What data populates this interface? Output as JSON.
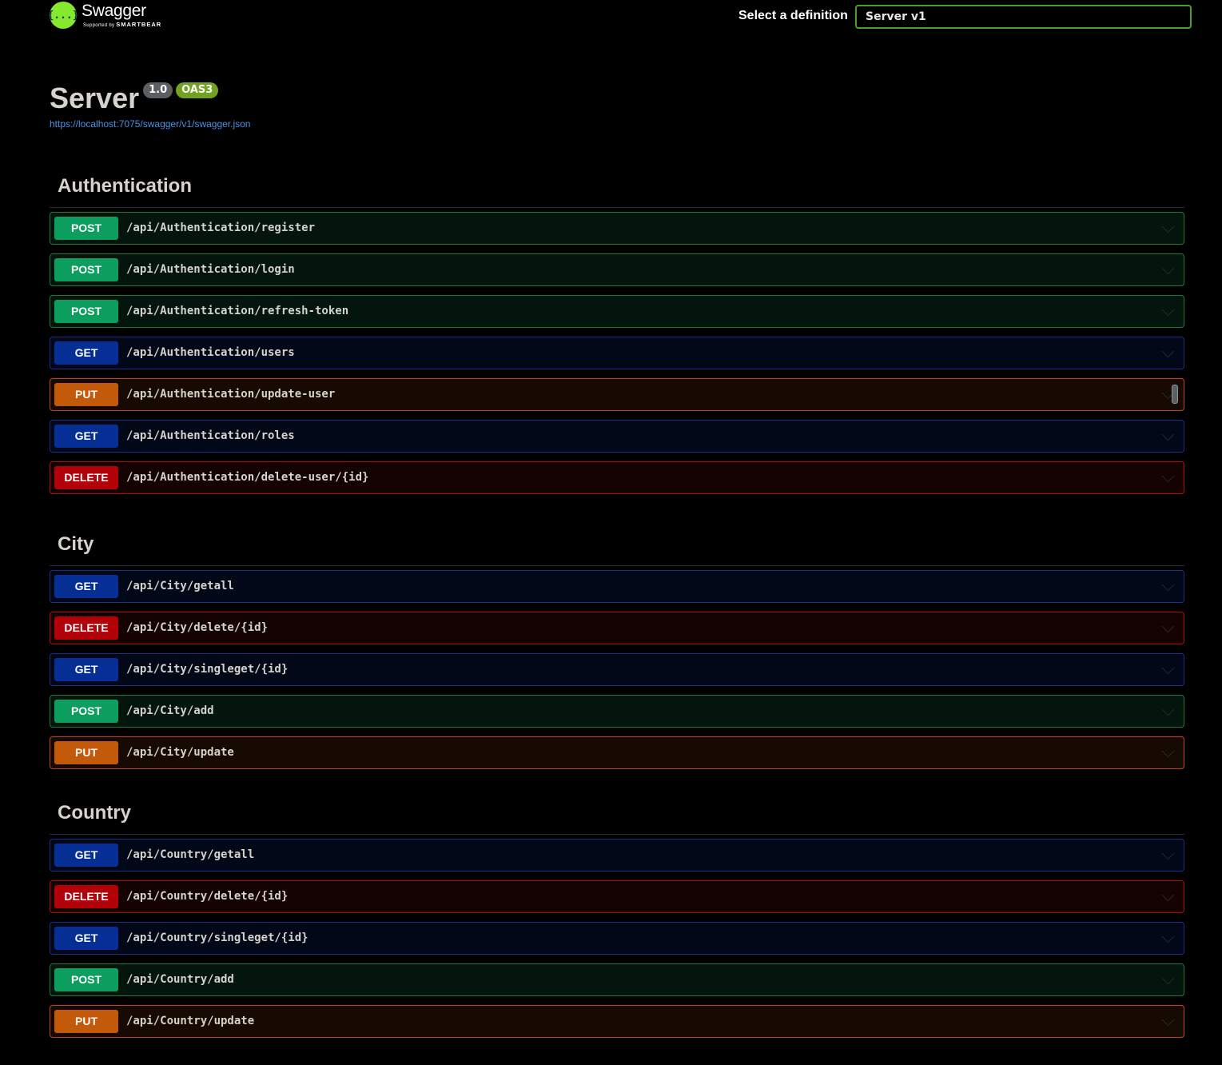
{
  "header": {
    "logo_word": "Swagger",
    "logo_sub_prefix": "Supported by ",
    "logo_sub_brand": "SMARTBEAR",
    "logo_glyph": "{...}",
    "definition_label": "Select a definition",
    "definition_value": "Server v1"
  },
  "info": {
    "title": "Server",
    "version": "1.0",
    "oas": "OAS3",
    "spec_url": "https://localhost:7075/swagger/v1/swagger.json"
  },
  "colors": {
    "post": "#0b9e5e",
    "get": "#062f96",
    "put": "#c25a0a",
    "delete": "#b20109",
    "logo": "#85ea2d"
  },
  "sections": [
    {
      "title": "Authentication",
      "operations": [
        {
          "method": "POST",
          "path": "/api/Authentication/register"
        },
        {
          "method": "POST",
          "path": "/api/Authentication/login"
        },
        {
          "method": "POST",
          "path": "/api/Authentication/refresh-token"
        },
        {
          "method": "GET",
          "path": "/api/Authentication/users"
        },
        {
          "method": "PUT",
          "path": "/api/Authentication/update-user"
        },
        {
          "method": "GET",
          "path": "/api/Authentication/roles"
        },
        {
          "method": "DELETE",
          "path": "/api/Authentication/delete-user/{id}"
        }
      ]
    },
    {
      "title": "City",
      "operations": [
        {
          "method": "GET",
          "path": "/api/City/getall"
        },
        {
          "method": "DELETE",
          "path": "/api/City/delete/{id}"
        },
        {
          "method": "GET",
          "path": "/api/City/singleget/{id}"
        },
        {
          "method": "POST",
          "path": "/api/City/add"
        },
        {
          "method": "PUT",
          "path": "/api/City/update"
        }
      ]
    },
    {
      "title": "Country",
      "operations": [
        {
          "method": "GET",
          "path": "/api/Country/getall"
        },
        {
          "method": "DELETE",
          "path": "/api/Country/delete/{id}"
        },
        {
          "method": "GET",
          "path": "/api/Country/singleget/{id}"
        },
        {
          "method": "POST",
          "path": "/api/Country/add"
        },
        {
          "method": "PUT",
          "path": "/api/Country/update"
        }
      ]
    }
  ]
}
